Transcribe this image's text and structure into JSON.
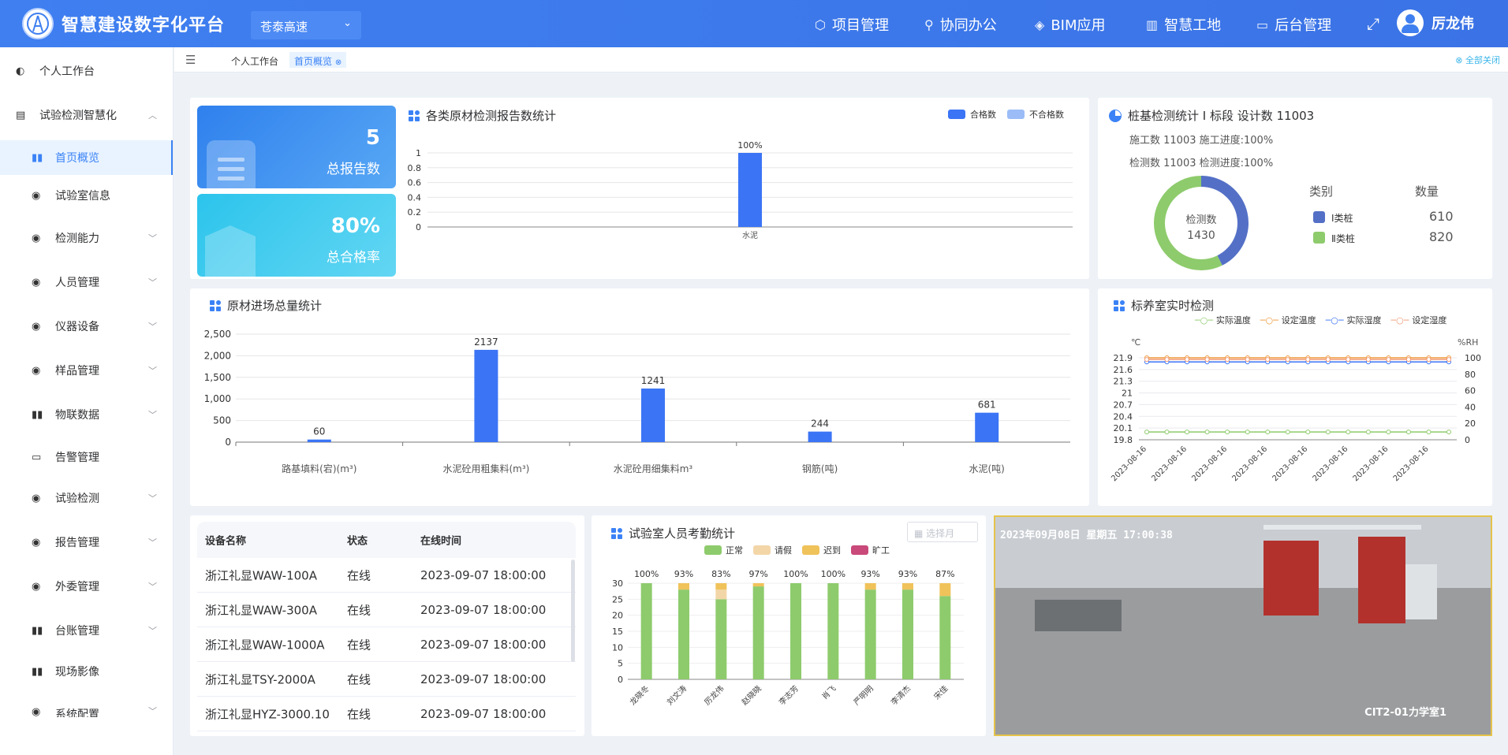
{
  "header": {
    "app_title": "智慧建设数字化平台",
    "project": "苍泰高速",
    "nav": [
      {
        "label": "项目管理",
        "icon": "cube-icon"
      },
      {
        "label": "协同办公",
        "icon": "org-icon"
      },
      {
        "label": "BIM应用",
        "icon": "box-icon"
      },
      {
        "label": "智慧工地",
        "icon": "building-icon"
      },
      {
        "label": "后台管理",
        "icon": "monitor-icon"
      }
    ],
    "user": "厉龙伟"
  },
  "sidebar": {
    "items": [
      {
        "label": "个人工作台",
        "icon": "dashboard-icon"
      },
      {
        "label": "试验检测智慧化",
        "icon": "document-icon"
      },
      {
        "label": "首页概览",
        "icon": "bar-chart-icon"
      },
      {
        "label": "试验室信息",
        "icon": "globe-icon"
      },
      {
        "label": "检测能力",
        "icon": "globe-icon"
      },
      {
        "label": "人员管理",
        "icon": "globe-icon"
      },
      {
        "label": "仪器设备",
        "icon": "globe-icon"
      },
      {
        "label": "样品管理",
        "icon": "globe-icon"
      },
      {
        "label": "物联数据",
        "icon": "bar-chart-icon"
      },
      {
        "label": "告警管理",
        "icon": "monitor-chart-icon"
      },
      {
        "label": "试验检测",
        "icon": "globe-icon"
      },
      {
        "label": "报告管理",
        "icon": "globe-icon"
      },
      {
        "label": "外委管理",
        "icon": "globe-icon"
      },
      {
        "label": "台账管理",
        "icon": "bar-chart-icon"
      },
      {
        "label": "现场影像",
        "icon": "bar-chart-icon"
      },
      {
        "label": "系统配置",
        "icon": "globe-icon"
      }
    ]
  },
  "tabs": {
    "items": [
      "个人工作台",
      "首页概览"
    ],
    "close_all": "全部关闭"
  },
  "stats": {
    "total_reports_value": "5",
    "total_reports_label": "总报告数",
    "pass_rate_value": "80%",
    "pass_rate_label": "总合格率"
  },
  "colors": {
    "primary": "#3b74f5",
    "light_blue": "#9bbcf7",
    "green": "#8ecb6c",
    "orange": "#ee9a3d",
    "pink": "#c8497a",
    "leave": "#f3d6a8",
    "late": "#f0c25a"
  },
  "report_chart": {
    "title": "各类原材检测报告数统计",
    "legend": [
      "合格数",
      "不合格数"
    ],
    "chart_data": {
      "type": "bar",
      "categories": [
        "水泥"
      ],
      "series": [
        {
          "name": "合格数",
          "values": [
            1
          ]
        },
        {
          "name": "不合格数",
          "values": [
            0
          ]
        }
      ],
      "data_labels": [
        "100%"
      ],
      "yticks": [
        "0",
        "0.2",
        "0.4",
        "0.6",
        "0.8",
        "1"
      ],
      "ylim": [
        0,
        1
      ]
    }
  },
  "pile_stats": {
    "title": "桩基检测统计  Ⅰ 标段   设计数  11003",
    "line1": "施工数  11003  施工进度:100%",
    "line2": "检测数  11003  检测进度:100%",
    "donut_label": "检测数",
    "donut_value": "1430",
    "col_category": "类别",
    "col_count": "数量",
    "chart_data": {
      "type": "pie",
      "categories": [
        "Ⅰ类桩",
        "Ⅱ类桩"
      ],
      "values": [
        610,
        820
      ]
    }
  },
  "material_chart": {
    "title": "原材进场总量统计",
    "chart_data": {
      "type": "bar",
      "categories": [
        "路基填料(宕)(m³)",
        "水泥砼用粗集料(m³)",
        "水泥砼用细集料m³",
        "钢筋(吨)",
        "水泥(吨)"
      ],
      "values": [
        60,
        2137,
        1241,
        244,
        681
      ],
      "yticks": [
        "0",
        "500",
        "1,000",
        "1,500",
        "2,000",
        "2,500"
      ],
      "ylim": [
        0,
        2500
      ]
    }
  },
  "curing_chart": {
    "title": "标养室实时检测",
    "legend": [
      "实际温度",
      "设定温度",
      "实际湿度",
      "设定湿度"
    ],
    "left_unit": "℃",
    "right_unit": "%RH",
    "left_ticks": [
      "19.8",
      "20.1",
      "20.4",
      "20.7",
      "21",
      "21.3",
      "21.6",
      "21.9"
    ],
    "right_ticks": [
      "0",
      "20",
      "40",
      "60",
      "80",
      "100"
    ],
    "x_label": "2023-08-16",
    "chart_data": {
      "type": "line",
      "x": [
        "2023-08-16",
        "2023-08-16",
        "2023-08-16",
        "2023-08-16",
        "2023-08-16",
        "2023-08-16",
        "2023-08-16",
        "2023-08-16",
        "2023-08-16",
        "2023-08-16",
        "2023-08-16",
        "2023-08-16",
        "2023-08-16",
        "2023-08-16",
        "2023-08-16",
        "2023-08-16"
      ],
      "series": [
        {
          "name": "实际温度",
          "axis": "left",
          "value": 20.0
        },
        {
          "name": "设定温度",
          "axis": "left",
          "value": 21.9
        },
        {
          "name": "实际湿度",
          "axis": "right",
          "value": 95
        },
        {
          "name": "设定湿度",
          "axis": "right",
          "value": 98
        }
      ],
      "ylim_left": [
        19.8,
        21.9
      ],
      "ylim_right": [
        0,
        100
      ]
    }
  },
  "devices": {
    "headers": [
      "设备名称",
      "状态",
      "在线时间"
    ],
    "rows": [
      [
        "浙江礼显WAW-100A",
        "在线",
        "2023-09-07 18:00:00"
      ],
      [
        "浙江礼显WAW-300A",
        "在线",
        "2023-09-07 18:00:00"
      ],
      [
        "浙江礼显WAW-1000A",
        "在线",
        "2023-09-07 18:00:00"
      ],
      [
        "浙江礼显TSY-2000A",
        "在线",
        "2023-09-07 18:00:00"
      ],
      [
        "浙江礼显HYZ-3000.10",
        "在线",
        "2023-09-07 18:00:00"
      ]
    ]
  },
  "attendance": {
    "title": "试验室人员考勤统计",
    "month_placeholder": "选择月",
    "legend": [
      "正常",
      "请假",
      "迟到",
      "旷工"
    ],
    "yticks": [
      "0",
      "5",
      "10",
      "15",
      "20",
      "25",
      "30"
    ],
    "chart_data": {
      "type": "bar",
      "stacked": true,
      "categories": [
        "龙晓冬",
        "刘文涛",
        "厉龙伟",
        "赵晓晓",
        "李志芳",
        "肖飞",
        "严明明",
        "李清杰",
        "宋佳"
      ],
      "series": [
        {
          "name": "正常",
          "values": [
            30,
            28,
            25,
            29,
            30,
            30,
            28,
            28,
            26
          ]
        },
        {
          "name": "请假",
          "values": [
            0,
            0,
            3,
            0,
            0,
            0,
            0,
            0,
            0
          ]
        },
        {
          "name": "迟到",
          "values": [
            0,
            2,
            2,
            1,
            0,
            0,
            2,
            2,
            4
          ]
        },
        {
          "name": "旷工",
          "values": [
            0,
            0,
            0,
            0,
            0,
            0,
            0,
            0,
            0
          ]
        }
      ],
      "data_labels": [
        "100%",
        "93%",
        "83%",
        "97%",
        "100%",
        "100%",
        "93%",
        "93%",
        "87%"
      ],
      "ylim": [
        0,
        30
      ]
    }
  },
  "camera": {
    "timestamp": "2023年09月08日  星期五  17:00:38",
    "label": "CIT2-01力学室1"
  }
}
